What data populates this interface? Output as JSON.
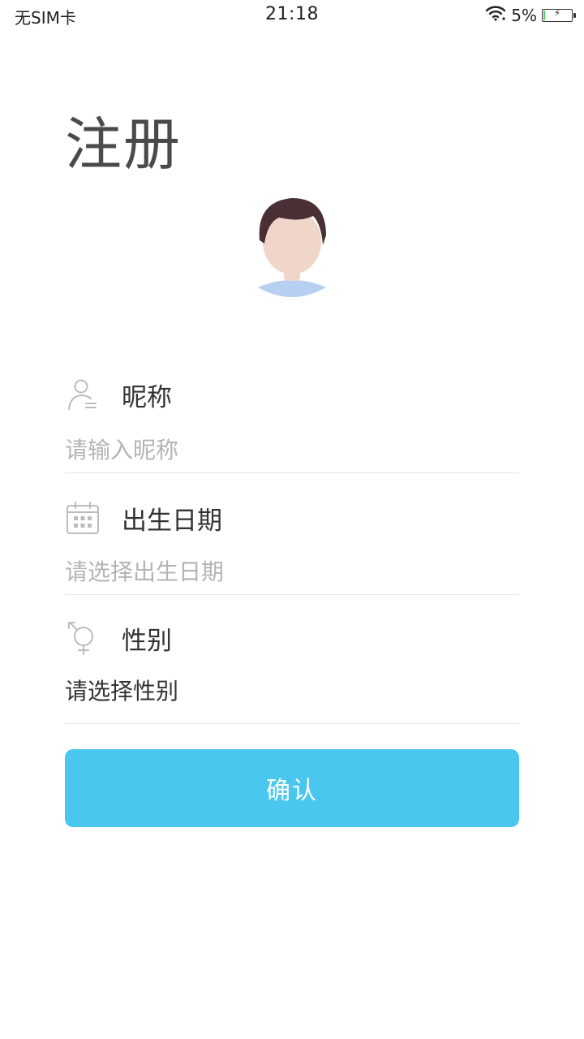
{
  "status_bar": {
    "carrier": "无SIM卡",
    "time": "21:18",
    "battery_percent_text": "5%",
    "battery_level": 0.05,
    "wifi_icon": "wifi-icon",
    "battery_icon": "battery-charging-icon"
  },
  "page": {
    "title": "注册",
    "avatar_icon": "avatar-icon"
  },
  "form": {
    "nickname": {
      "icon": "user-icon",
      "label": "昵称",
      "placeholder": "请输入昵称",
      "value": ""
    },
    "birthday": {
      "icon": "calendar-icon",
      "label": "出生日期",
      "placeholder": "请选择出生日期",
      "value": ""
    },
    "gender": {
      "icon": "gender-icon",
      "label": "性别",
      "value": "请选择性别"
    },
    "confirm_label": "确认"
  },
  "colors": {
    "accent": "#4ac7ef",
    "title_text": "#4a4a4a",
    "label_text": "#333333",
    "placeholder_text": "#b4b4b4",
    "value_text": "#333333",
    "divider": "#e8e8e8",
    "icon_gray": "#bcbcbc",
    "hair": "#4a3035",
    "skin": "#efd6c9",
    "shirt": "#b7cff0",
    "battery_fill": "#4cd964"
  }
}
